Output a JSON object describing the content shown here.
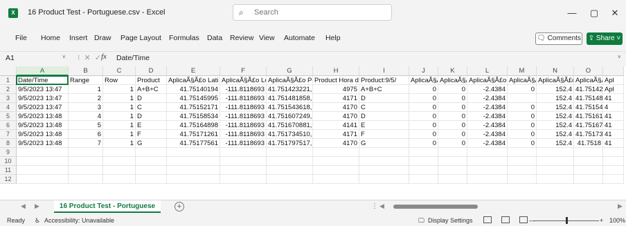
{
  "app": {
    "icon_letter": "X",
    "title": "16 Product Test - Portuguese.csv  -  Excel",
    "accent": "#107c41"
  },
  "search": {
    "placeholder": "Search"
  },
  "window_controls": {
    "minimize": "—",
    "maximize": "▢",
    "close": "✕"
  },
  "menu": [
    "File",
    "Home",
    "Insert",
    "Draw",
    "Page Layout",
    "Formulas",
    "Data",
    "Review",
    "View",
    "Automate",
    "Help"
  ],
  "buttons": {
    "comments": "Comments",
    "share": "Share"
  },
  "formula_bar": {
    "name_box": "A1",
    "fx": "fx",
    "content": "Date/Time"
  },
  "grid": {
    "columns": [
      "A",
      "B",
      "C",
      "D",
      "E",
      "F",
      "G",
      "H",
      "I",
      "J",
      "K",
      "L",
      "M",
      "N",
      "O"
    ],
    "row_numbers": [
      "1",
      "2",
      "3",
      "4",
      "5",
      "6",
      "7",
      "8",
      "9",
      "10",
      "11",
      "12"
    ],
    "rows": [
      [
        "Date/Time",
        "Range",
        "Row",
        "Product",
        "AplicaÃ§Ã£o Lati",
        "AplicaÃ§Ã£o Lo",
        "AplicaÃ§Ã£o Po",
        "Product Hora d",
        "Product:9/5/",
        "AplicaÃ§Ã",
        "AplicaÃ§Ã",
        "AplicaÃ§Ã£o",
        "AplicaÃ§Ã",
        "AplicaÃ§Ã£o",
        "AplicaÃ§Ã"
      ],
      [
        "9/5/2023 13:47",
        "1",
        "1",
        "A+B+C",
        "41.75140194",
        "-111.8118693",
        "41.751423221, -",
        "4975",
        "A+B+C",
        "0",
        "0",
        "-2.4384",
        "0",
        "152.4",
        "41.75142"
      ],
      [
        "9/5/2023 13:47",
        "2",
        "1",
        "D",
        "41.75145995",
        "-111.8118693",
        "41.751481858, -",
        "4171",
        "D",
        "0",
        "0",
        "-2.4384",
        "",
        "152.4",
        "41.75148"
      ],
      [
        "9/5/2023 13:47",
        "3",
        "1",
        "C",
        "41.75152171",
        "-111.8118693",
        "41.751543618, -",
        "4170",
        "C",
        "0",
        "0",
        "-2.4384",
        "0",
        "152.4",
        "41.75154"
      ],
      [
        "9/5/2023 13:48",
        "4",
        "1",
        "D",
        "41.75158534",
        "-111.8118693",
        "41.751607249, -",
        "4170",
        "D",
        "0",
        "0",
        "-2.4384",
        "0",
        "152.4",
        "41.75161"
      ],
      [
        "9/5/2023 13:48",
        "5",
        "1",
        "E",
        "41.75164898",
        "-111.8118693",
        "41.751670881, -",
        "4141",
        "E",
        "0",
        "0",
        "-2.4384",
        "0",
        "152.4",
        "41.75167"
      ],
      [
        "9/5/2023 13:48",
        "6",
        "1",
        "F",
        "41.75171261",
        "-111.8118693",
        "41.751734510, -",
        "4171",
        "F",
        "0",
        "0",
        "-2.4384",
        "0",
        "152.4",
        "41.75173"
      ],
      [
        "9/5/2023 13:48",
        "7",
        "1",
        "G",
        "41.75177561",
        "-111.8118693",
        "41.751797517, -",
        "4170",
        "G",
        "0",
        "0",
        "-2.4384",
        "0",
        "152.4",
        "41.7518"
      ]
    ],
    "overflow_col_P": [
      "Apl",
      "Apl",
      "41",
      "4",
      "41",
      "41",
      "41",
      "41"
    ]
  },
  "sheet_tabs": {
    "active": "16 Product Test - Portuguese",
    "add": "+"
  },
  "status": {
    "ready": "Ready",
    "accessibility": "Accessibility: Unavailable",
    "display_settings": "Display Settings",
    "zoom_minus": "—",
    "zoom_plus": "+",
    "zoom": "100%"
  }
}
